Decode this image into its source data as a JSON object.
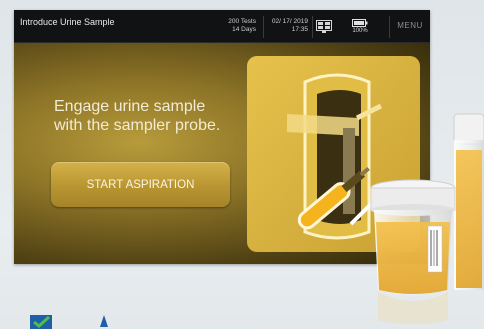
{
  "header": {
    "title": "Introduce Urine Sample",
    "tests": "200 Tests",
    "days": "14 Days",
    "date": "02/ 17/ 2019",
    "time": "17:35",
    "battery": "100%",
    "menu_label": "MENU"
  },
  "main": {
    "prompt_line1": "Engage urine sample",
    "prompt_line2": "with the sampler probe.",
    "start_button_label": "START ASPIRATION"
  },
  "icons": {
    "network": "network-status-icon",
    "battery": "battery-icon",
    "illustration": "sampler-probe-illustration",
    "photo": "urine-sample-cups-photo",
    "logo": "brand-logo-mark"
  },
  "colors": {
    "screen_gold": "#b79b3b",
    "button_gold": "#c9a43f",
    "illustration_panel": "#d9b53e",
    "header_bg": "#101214"
  }
}
